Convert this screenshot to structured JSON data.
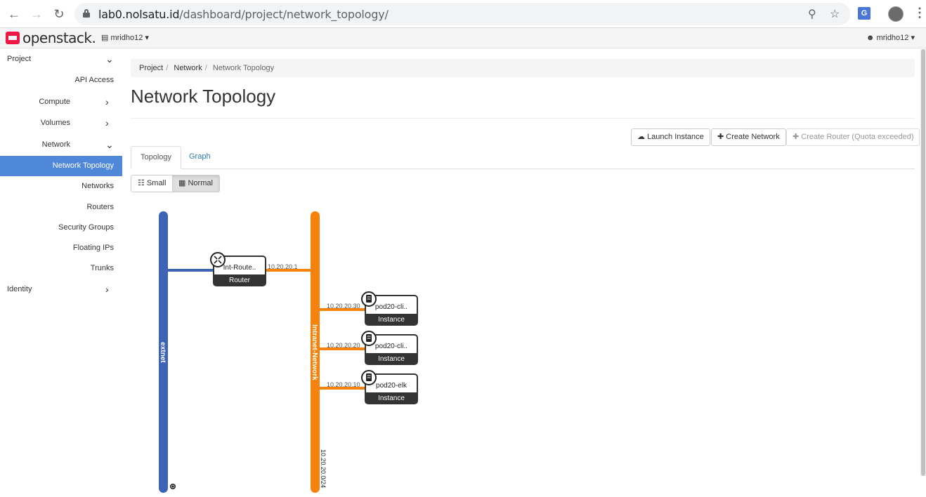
{
  "browser": {
    "url_host": "lab0.nolsatu.id",
    "url_path": "/dashboard/project/network_topology/"
  },
  "topbar": {
    "logo_text": "openstack.",
    "project_selector": "mridho12",
    "user_menu": "mridho12"
  },
  "sidebar": {
    "items": [
      {
        "label": "Project"
      },
      {
        "label": "API Access"
      },
      {
        "label": "Compute"
      },
      {
        "label": "Volumes"
      },
      {
        "label": "Network"
      },
      {
        "label": "Network Topology"
      },
      {
        "label": "Networks"
      },
      {
        "label": "Routers"
      },
      {
        "label": "Security Groups"
      },
      {
        "label": "Floating IPs"
      },
      {
        "label": "Trunks"
      },
      {
        "label": "Identity"
      }
    ],
    "active_color": "#4f88d8"
  },
  "breadcrumb": {
    "items": [
      "Project",
      "Network",
      "Network Topology"
    ]
  },
  "page": {
    "title": "Network Topology"
  },
  "actions": {
    "launch_instance": "Launch Instance",
    "create_network": "Create Network",
    "create_router": "Create Router (Quota exceeded)"
  },
  "tabs": [
    {
      "label": "Topology",
      "active": true
    },
    {
      "label": "Graph",
      "active": false
    }
  ],
  "view_toggle": {
    "small": "Small",
    "normal": "Normal",
    "selected": "Normal"
  },
  "topology": {
    "networks": [
      {
        "name": "extnet",
        "color": "#3d64b4"
      },
      {
        "name": "Intranet-Network",
        "color": "#f5820a",
        "cidr": "10.20.20.0/24"
      }
    ],
    "router": {
      "name": "Int-Route..",
      "type": "Router",
      "ip": "10.20.20.1"
    },
    "instances": [
      {
        "name": "pod20-cli..",
        "type": "Instance",
        "ip": "10.20.20.30"
      },
      {
        "name": "pod20-cli..",
        "type": "Instance",
        "ip": "10.20.20.20"
      },
      {
        "name": "pod20-elk",
        "type": "Instance",
        "ip": "10.20.20.10"
      }
    ]
  }
}
